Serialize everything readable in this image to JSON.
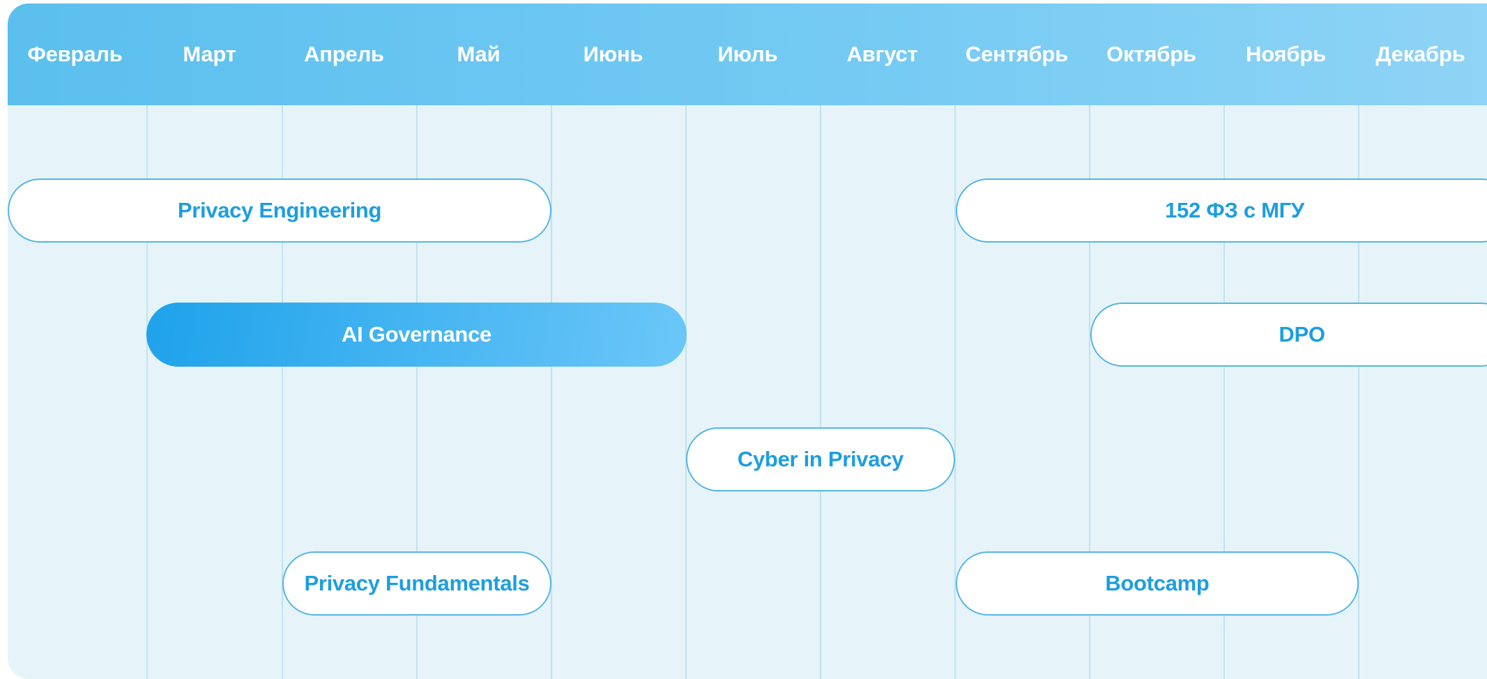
{
  "months": [
    "Февраль",
    "Март",
    "Апрель",
    "Май",
    "Июнь",
    "Июль",
    "Август",
    "Сентябрь",
    "Октябрь",
    "Ноябрь",
    "Декабрь"
  ],
  "courses": [
    {
      "label": "Privacy Engineering",
      "start_month": "Февраль",
      "end_month": "Май",
      "active": false
    },
    {
      "label": "152 ФЗ с МГУ",
      "start_month": "Сентябрь",
      "end_month": "Декабрь",
      "active": false
    },
    {
      "label": "AI Governance",
      "start_month": "Март",
      "end_month": "Июнь",
      "active": true
    },
    {
      "label": "DPO",
      "start_month": "Октябрь",
      "end_month": "Декабрь",
      "active": false
    },
    {
      "label": "Cyber in Privacy",
      "start_month": "Июль",
      "end_month": "Август",
      "active": false
    },
    {
      "label": "Privacy Fundamentals",
      "start_month": "Апрель",
      "end_month": "Май",
      "active": false
    },
    {
      "label": "Bootcamp",
      "start_month": "Сентябрь",
      "end_month": "Ноябрь",
      "active": false
    }
  ],
  "colors": {
    "header_gradient_start": "#5bbfee",
    "header_gradient_end": "#8fd4f6",
    "background": "#e6f4fa",
    "accent": "#1c9ee0",
    "active_bar": "#1ea2ea"
  }
}
